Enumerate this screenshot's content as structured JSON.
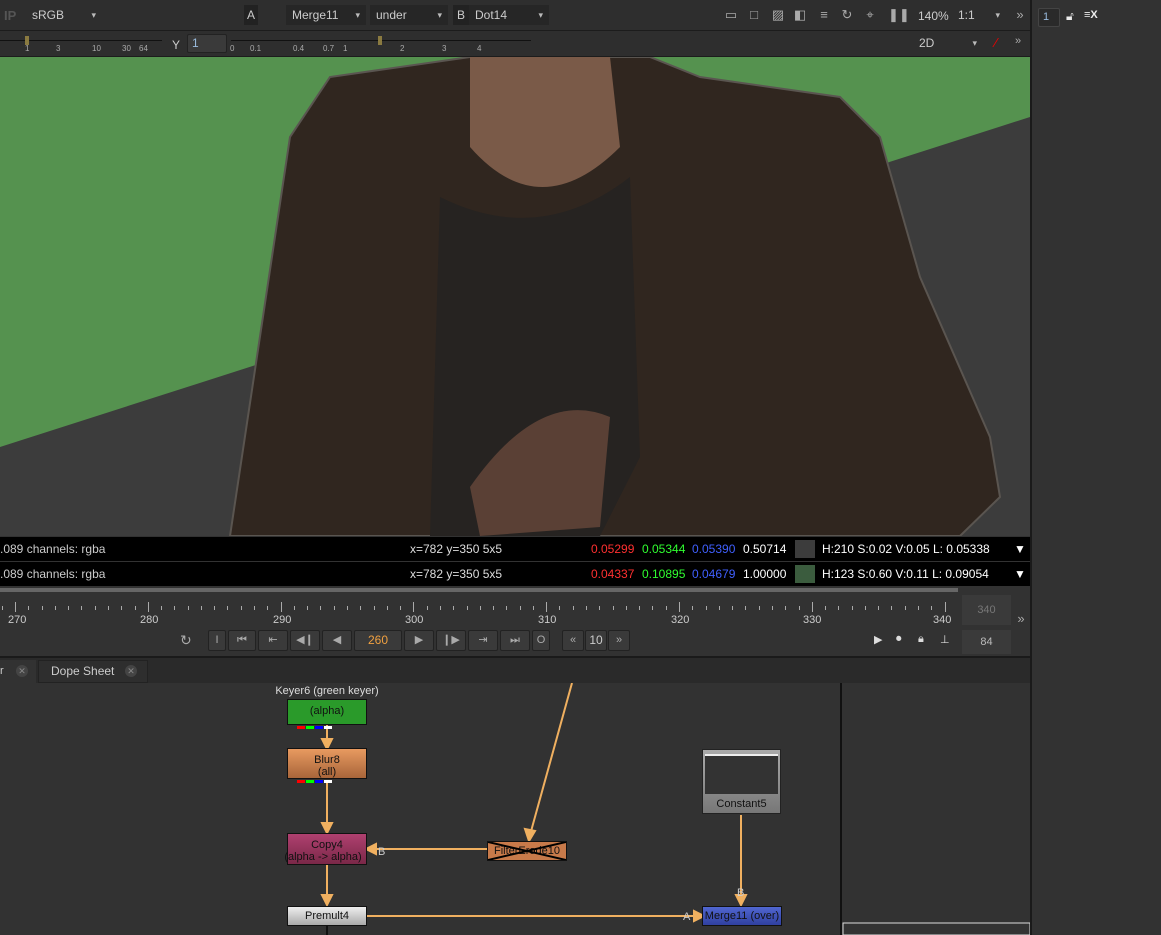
{
  "toolbar": {
    "ip_label": "IP",
    "colorspace": "sRGB",
    "input_a_label": "A",
    "input_a": "Merge11",
    "composite_mode": "under",
    "input_b_label": "B",
    "input_b": "Dot14",
    "zoom": "140%",
    "ratio": "1:1"
  },
  "toolbar2": {
    "gain_ticks": [
      "1",
      "3",
      "10",
      "30",
      "64"
    ],
    "gamma_label": "Y",
    "gamma_value": "1",
    "gamma_ticks": [
      "0",
      "0.1",
      "0.4",
      "0.7",
      "1",
      "2",
      "3",
      "4"
    ],
    "view_mode": "2D"
  },
  "side": {
    "frame_value": "1"
  },
  "info": [
    {
      "channels": ".089 channels: rgba",
      "coords": "x=782 y=350 5x5",
      "r": "0.05299",
      "g": "0.05344",
      "b": "0.05390",
      "a": "0.50714",
      "swatch": "#3c3c3c",
      "hsv": "H:210 S:0.02 V:0.05  L: 0.05338"
    },
    {
      "channels": ".089 channels: rgba",
      "coords": "x=782 y=350 5x5",
      "r": "0.04337",
      "g": "0.10895",
      "b": "0.04679",
      "a": "1.00000",
      "swatch": "#3b5c3e",
      "hsv": "H:123 S:0.60 V:0.11  L: 0.09054"
    }
  ],
  "timeline": {
    "ticks": [
      "270",
      "280",
      "290",
      "300",
      "310",
      "320",
      "330",
      "340"
    ],
    "end_frame": "340",
    "current_frame": "260",
    "step": "10",
    "in_label": "I",
    "out_label": "O",
    "fps": "84"
  },
  "tabs": [
    {
      "label": "r"
    },
    {
      "label": "Dope Sheet"
    }
  ],
  "nodes": {
    "keyer": "Keyer6 (green keyer)",
    "keyer_sub": "(alpha)",
    "blur": "Blur8",
    "blur_sub": "(all)",
    "copy": "Copy4",
    "copy_sub": "(alpha -> alpha)",
    "filter": "FilterErode10",
    "constant": "Constant5",
    "premult": "Premult4",
    "merge": "Merge11 (over)",
    "pipe_a": "A",
    "pipe_b": "B"
  },
  "colors": {
    "accent_orange": "#f0a850",
    "red": "#ff3030",
    "green": "#30ff30",
    "blue": "#4040ff"
  }
}
